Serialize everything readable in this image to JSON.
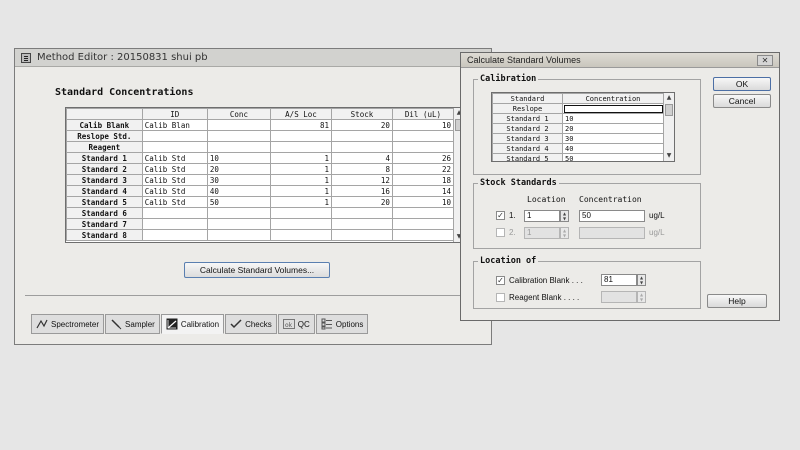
{
  "main_window": {
    "title": "Method Editor : 20150831  shui pb",
    "section_title": "Standard Concentrations",
    "columns": [
      "",
      "ID",
      "Conc",
      "A/S Loc",
      "Stock",
      "Dil (uL)"
    ],
    "rows": [
      {
        "name": "Calib Blank",
        "id": "Calib Blan",
        "conc": "",
        "loc": "81",
        "stock": "20",
        "dil": "10"
      },
      {
        "name": "Reslope Std.",
        "id": "",
        "conc": "",
        "loc": "",
        "stock": "",
        "dil": ""
      },
      {
        "name": "Reagent",
        "id": "",
        "conc": "",
        "loc": "",
        "stock": "",
        "dil": ""
      },
      {
        "name": "Standard 1",
        "id": "Calib Std",
        "conc": "10",
        "loc": "1",
        "stock": "4",
        "dil": "26"
      },
      {
        "name": "Standard 2",
        "id": "Calib Std",
        "conc": "20",
        "loc": "1",
        "stock": "8",
        "dil": "22"
      },
      {
        "name": "Standard 3",
        "id": "Calib Std",
        "conc": "30",
        "loc": "1",
        "stock": "12",
        "dil": "18"
      },
      {
        "name": "Standard 4",
        "id": "Calib Std",
        "conc": "40",
        "loc": "1",
        "stock": "16",
        "dil": "14"
      },
      {
        "name": "Standard 5",
        "id": "Calib Std",
        "conc": "50",
        "loc": "1",
        "stock": "20",
        "dil": "10"
      },
      {
        "name": "Standard 6",
        "id": "",
        "conc": "",
        "loc": "",
        "stock": "",
        "dil": ""
      },
      {
        "name": "Standard 7",
        "id": "",
        "conc": "",
        "loc": "",
        "stock": "",
        "dil": ""
      },
      {
        "name": "Standard 8",
        "id": "",
        "conc": "",
        "loc": "",
        "stock": "",
        "dil": ""
      }
    ],
    "calc_button": "Calculate Standard Volumes...",
    "tabs": [
      {
        "label": "Spectrometer",
        "icon": "spectrometer-icon"
      },
      {
        "label": "Sampler",
        "icon": "sampler-icon"
      },
      {
        "label": "Calibration",
        "icon": "calibration-icon"
      },
      {
        "label": "Checks",
        "icon": "checks-icon"
      },
      {
        "label": "QC",
        "icon": "qc-icon"
      },
      {
        "label": "Options",
        "icon": "options-icon"
      }
    ],
    "active_tab": "Calibration"
  },
  "dialog": {
    "title": "Calculate Standard Volumes",
    "ok": "OK",
    "cancel": "Cancel",
    "help": "Help",
    "calibration": {
      "label": "Calibration",
      "columns": [
        "Standard",
        "Concentration"
      ],
      "rows": [
        {
          "name": "Reslope",
          "conc": ""
        },
        {
          "name": "Standard 1",
          "conc": "10"
        },
        {
          "name": "Standard 2",
          "conc": "20"
        },
        {
          "name": "Standard 3",
          "conc": "30"
        },
        {
          "name": "Standard 4",
          "conc": "40"
        },
        {
          "name": "Standard 5",
          "conc": "50"
        }
      ]
    },
    "stock": {
      "label": "Stock Standards",
      "col_location": "Location",
      "col_concentration": "Concentration",
      "row1": {
        "num": "1.",
        "location": "1",
        "concentration": "50",
        "unit": "ug/L",
        "checked": true
      },
      "row2": {
        "num": "2.",
        "location": "1",
        "concentration": "",
        "unit": "ug/L",
        "checked": false
      }
    },
    "location": {
      "label": "Location of",
      "calib_blank": {
        "label": "Calibration Blank . . .",
        "value": "81",
        "checked": true
      },
      "reagent_blank": {
        "label": "Reagent Blank . . . .",
        "value": "",
        "checked": false
      }
    }
  },
  "colors": {
    "active_border": "#4c6fa5",
    "window_bg": "#ecebe8"
  }
}
